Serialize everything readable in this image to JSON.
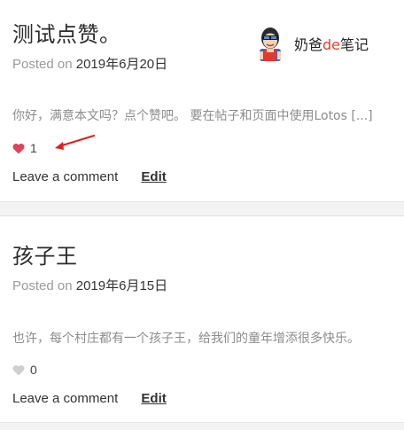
{
  "posts": [
    {
      "title": "测试点赞。",
      "posted_on_label": "Posted on",
      "date": "2019年6月20日",
      "excerpt": "你好，满意本文吗？点个赞吧。 要在帖子和页面中使用Lotos [...]",
      "like_count": "1",
      "liked": true,
      "comment_label": "Leave a comment",
      "edit_label": "Edit"
    },
    {
      "title": "孩子王",
      "posted_on_label": "Posted on",
      "date": "2019年6月15日",
      "excerpt": "也许，每个村庄都有一个孩子王，给我们的童年增添很多快乐。",
      "like_count": "0",
      "liked": false,
      "comment_label": "Leave a comment",
      "edit_label": "Edit"
    }
  ],
  "watermark": {
    "prefix": "奶爸",
    "accent": "de",
    "suffix": "笔记",
    "accent_color": "#e5412f"
  },
  "colors": {
    "heart_active": "#e0435a",
    "heart_inactive": "#cfcfcf",
    "annotation_arrow": "#e02020"
  },
  "icons": {
    "like": "heart-icon",
    "avatar": "avatar-icon",
    "annotation": "arrow-annotation-icon"
  }
}
